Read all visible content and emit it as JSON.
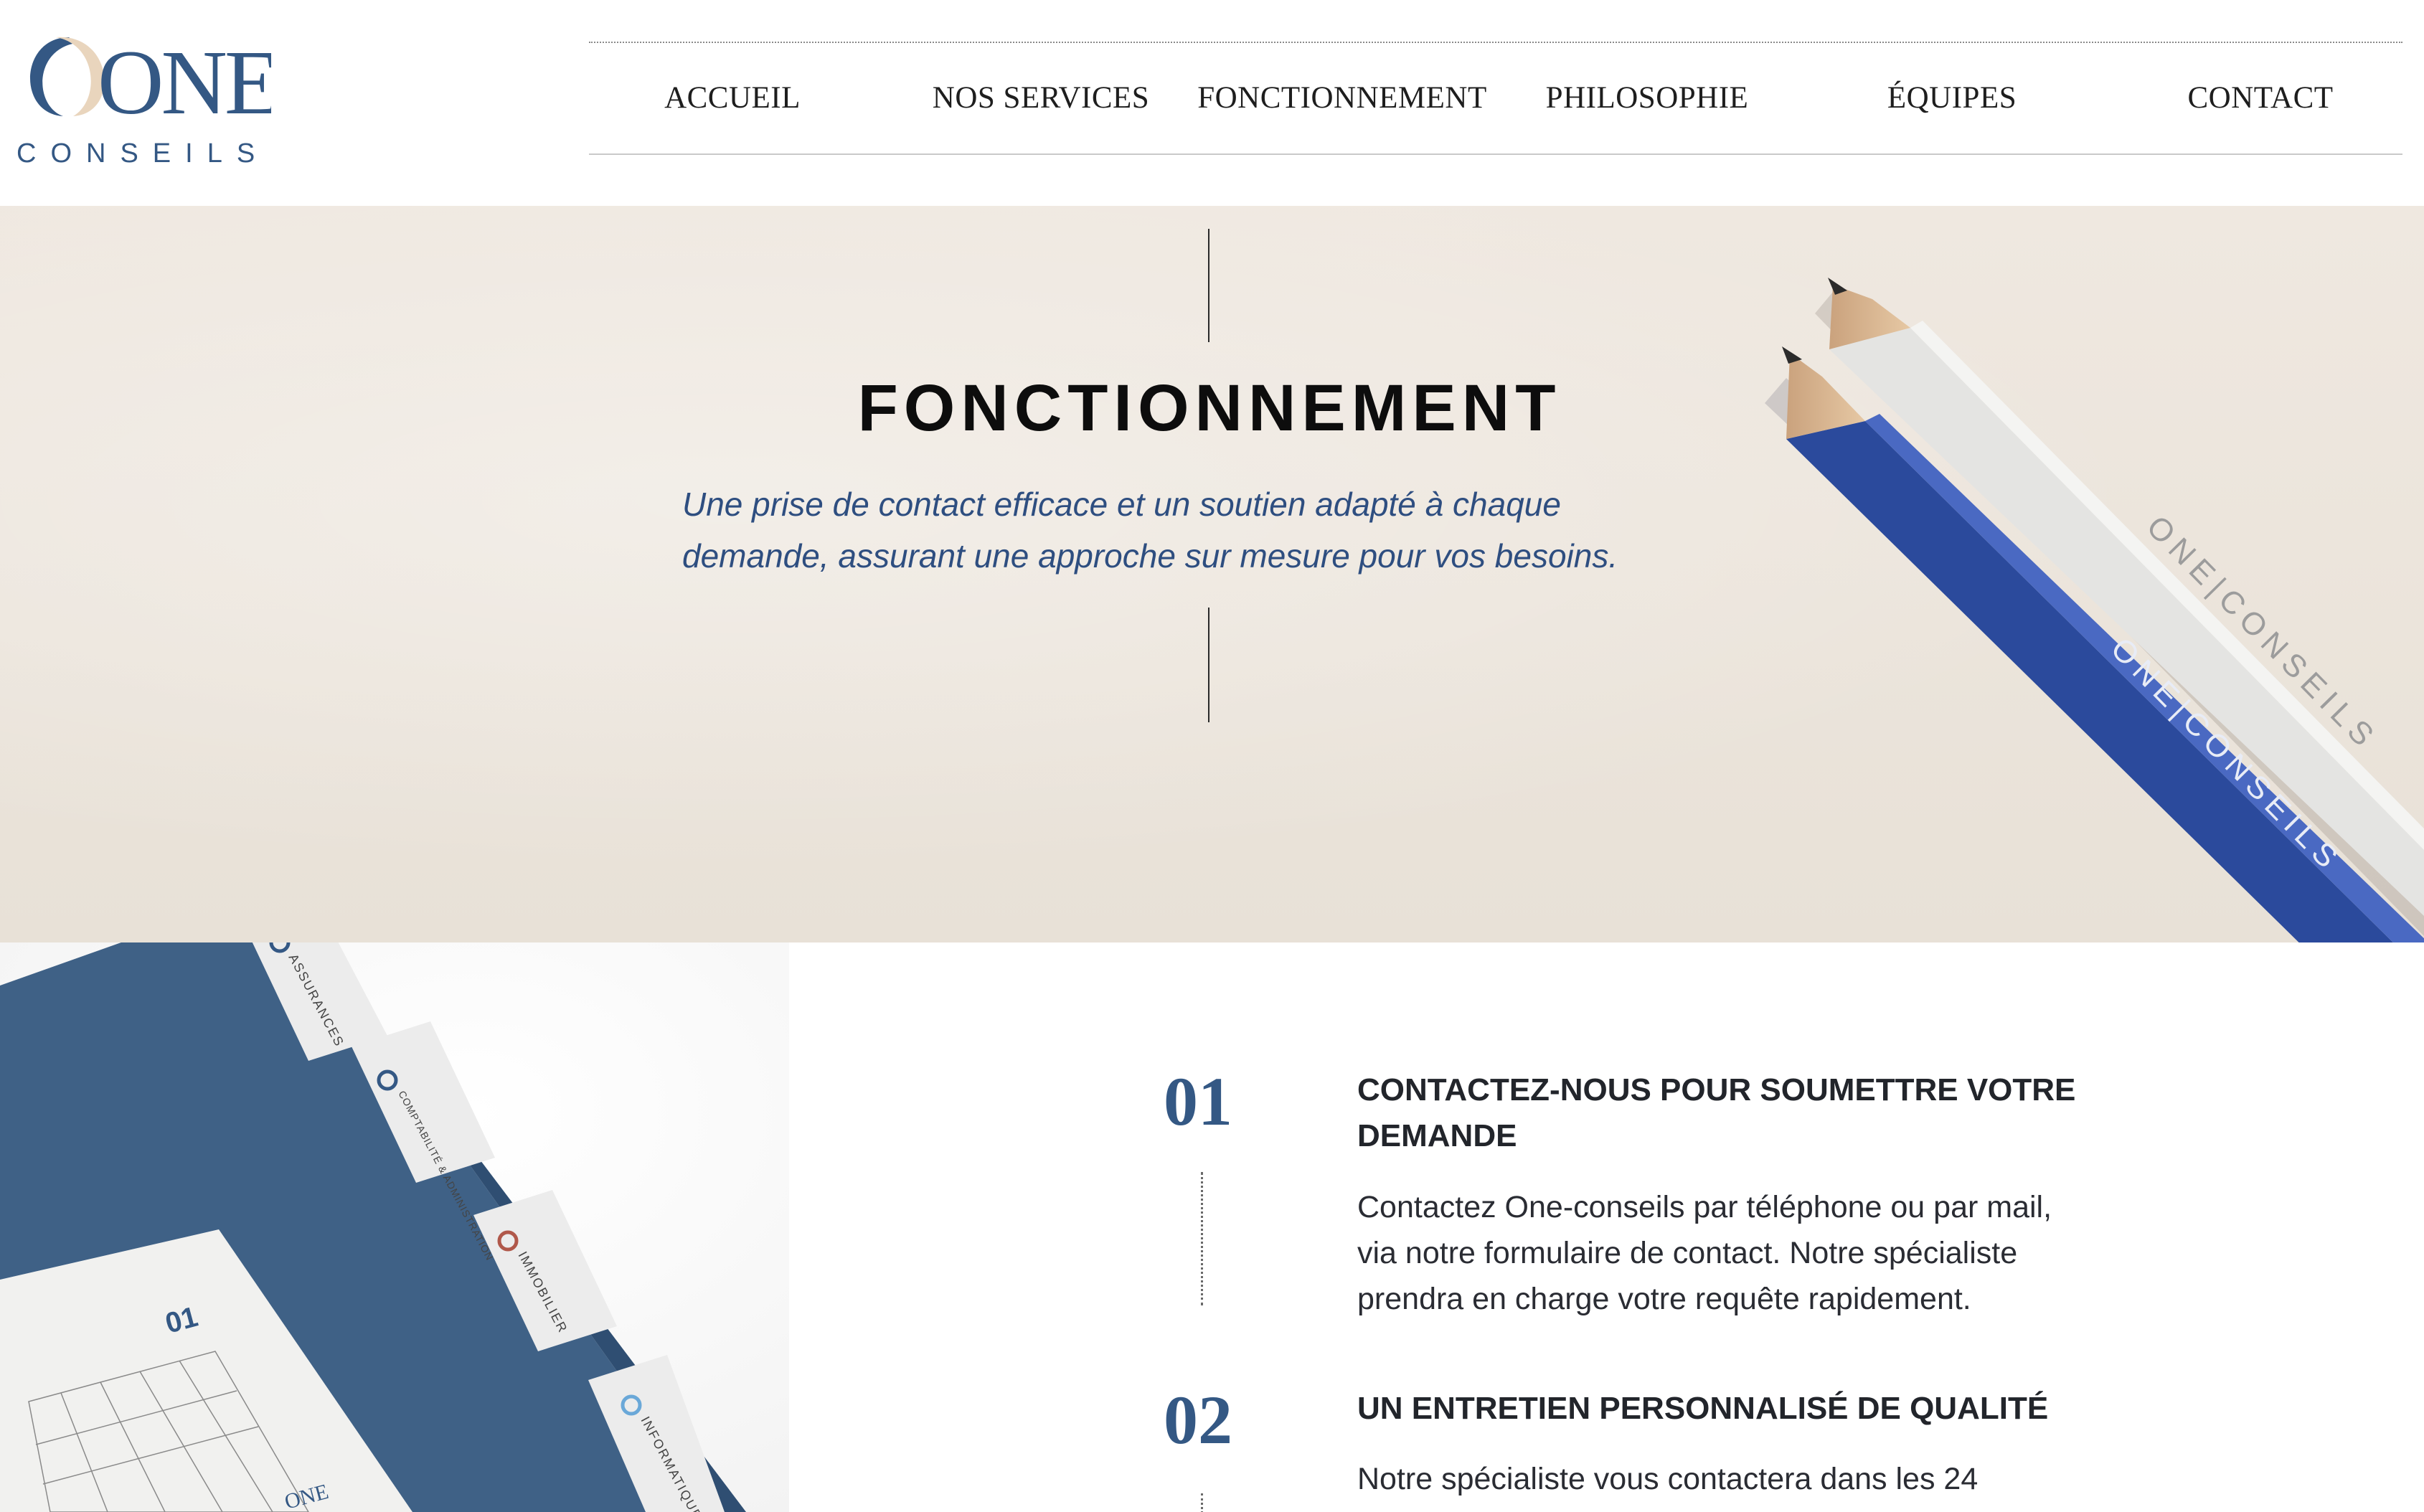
{
  "brand": {
    "logo_primary": "ONE",
    "logo_secondary": "CONSEILS",
    "colors": {
      "navy": "#345884",
      "beige": "#e9d5bd",
      "text": "#1e1e1e"
    }
  },
  "nav": {
    "items": [
      {
        "label": "ACCUEIL"
      },
      {
        "label": "NOS SERVICES"
      },
      {
        "label": "FONCTIONNEMENT"
      },
      {
        "label": "PHILOSOPHIE"
      },
      {
        "label": "ÉQUIPES"
      },
      {
        "label": "CONTACT"
      }
    ]
  },
  "hero": {
    "title": "FONCTIONNEMENT",
    "subtitle_line1": "Une prise de contact efficace et un soutien adapté à chaque",
    "subtitle_line2": "demande, assurant une approche sur mesure pour vos besoins.",
    "pencil_brand_1": "ONE|CONSEILS",
    "pencil_brand_2": "ONE|CONSEILS"
  },
  "folder": {
    "tabs": [
      "ASSURANCES",
      "COMPTABILITÉ & ADMINISTRATION",
      "IMMOBILIER",
      "INFORMATIQUE"
    ],
    "calendar_number": "01",
    "card_logo": "ONE"
  },
  "steps": [
    {
      "number": "01",
      "title_line1": "CONTACTEZ-NOUS POUR SOUMETTRE VOTRE",
      "title_line2": "DEMANDE",
      "text_line1": "Contactez One-conseils par téléphone ou par mail,",
      "text_line2": "via notre formulaire de contact. Notre spécialiste",
      "text_line3": "prendra en charge votre requête rapidement."
    },
    {
      "number": "02",
      "title_line1": "UN ENTRETIEN PERSONNALISÉ DE QUALITÉ",
      "text_line1": "Notre spécialiste vous contactera dans les 24"
    }
  ]
}
